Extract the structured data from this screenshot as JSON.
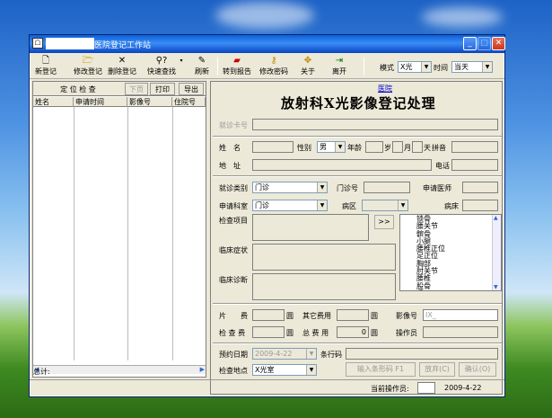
{
  "window": {
    "title": "医院登记工作站"
  },
  "toolbar": {
    "buttons": [
      {
        "label": "新登记",
        "icon": "doc"
      },
      {
        "label": "修改登记",
        "icon": "folder"
      },
      {
        "label": "删除登记",
        "icon": "x"
      },
      {
        "label": "快速查找",
        "icon": "search"
      },
      {
        "label": "刷新",
        "icon": "pen"
      },
      {
        "label": "转到报告",
        "icon": "report"
      },
      {
        "label": "修改密码",
        "icon": "key"
      },
      {
        "label": "关于",
        "icon": "about"
      },
      {
        "label": "离开",
        "icon": "exit"
      }
    ],
    "mode_label": "模式",
    "mode_value": "X光",
    "time_label": "时间",
    "time_value": "当天"
  },
  "left": {
    "buttons": {
      "locate": "定 位 检 查",
      "next": "下页",
      "print": "打印",
      "export": "导出"
    },
    "columns": [
      "姓名",
      "申请时间",
      "影像号",
      "住院号"
    ],
    "total_label": "总计:"
  },
  "form": {
    "hospital": "医院",
    "title": "放射科X光影像登记处理",
    "card_label": "就诊卡号",
    "name_label": "姓　名",
    "sex_label": "性别",
    "sex_value": "男",
    "age_label": "年龄",
    "age_unit_year": "岁",
    "age_unit_month": "月",
    "age_unit_day": "天",
    "pinyin_label": "拼音",
    "address_label": "地　址",
    "phone_label": "电话",
    "visit_type_label": "就诊类别",
    "visit_type_value": "门诊",
    "clinic_no_label": "门诊号",
    "doctor_label": "申请医师",
    "dept_label": "申请科室",
    "dept_value": "门诊",
    "ward_label": "病区",
    "bed_label": "病床",
    "exam_item_label": "检查项目",
    "more_btn": ">>",
    "symptom_label": "临床症状",
    "diagnosis_label": "临床诊断",
    "body_parts": [
      "锁骨",
      "腰关节",
      "髌骨",
      "小腿",
      "腰椎正位",
      "足正位",
      "胸部",
      "肘关节",
      "腰椎",
      "股骨",
      "手"
    ],
    "film_fee_label": "片　　费",
    "yuan1": "圆",
    "other_fee_label": "其它费用",
    "yuan2": "圆",
    "image_no_label": "影像号",
    "image_no_value": "IX_",
    "exam_fee_label": "检 查 费",
    "yuan3": "圆",
    "total_fee_label": "总 费 用",
    "total_fee_value": "0",
    "yuan4": "圆",
    "operator_label": "操作员",
    "appt_date_label": "预约日期",
    "appt_date_value": "2009-4-22",
    "barcode_label": "条行码",
    "exam_place_label": "检查地点",
    "exam_place_value": "X光室",
    "input_barcode_btn": "输入条形码 F1",
    "cancel_btn": "放弃(C)",
    "confirm_btn": "确认(O)"
  },
  "status": {
    "operator_label": "当前操作员:",
    "date": "2009-4-22"
  }
}
